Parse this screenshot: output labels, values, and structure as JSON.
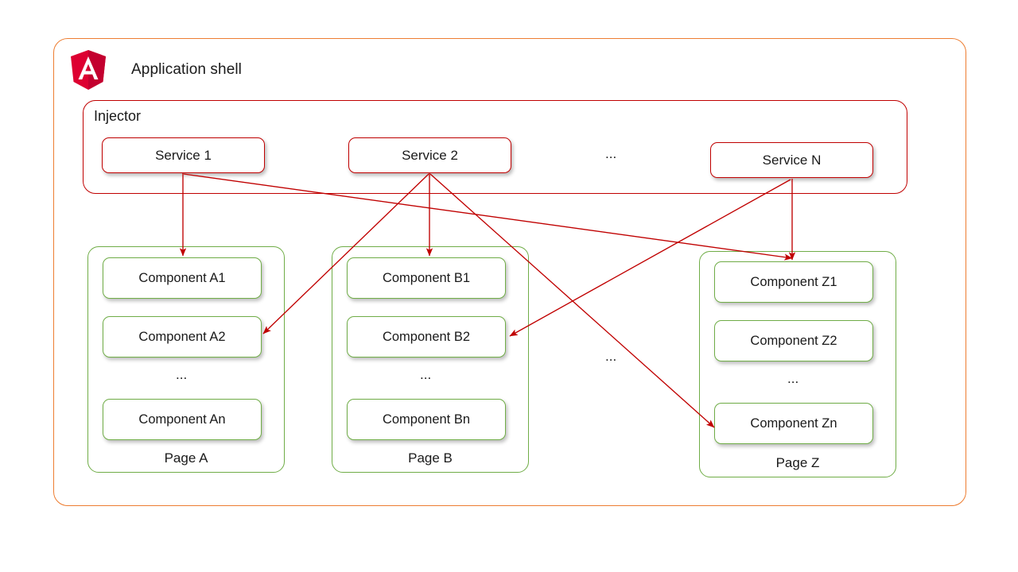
{
  "shell": {
    "title": "Application shell",
    "logo_icon": "angular-shield-icon",
    "border_color": "#ED7D31"
  },
  "injector": {
    "title": "Injector",
    "border_color": "#C00000",
    "services": [
      {
        "label": "Service 1"
      },
      {
        "label": "Service 2"
      },
      {
        "label": "Service N"
      }
    ],
    "services_ellipsis": "..."
  },
  "pages_ellipsis": "...",
  "pages": [
    {
      "label": "Page A",
      "border_color": "#70AD47",
      "components": [
        {
          "label": "Component A1"
        },
        {
          "label": "Component A2"
        },
        {
          "label": "Component An"
        }
      ],
      "ellipsis": "..."
    },
    {
      "label": "Page B",
      "border_color": "#70AD47",
      "components": [
        {
          "label": "Component B1"
        },
        {
          "label": "Component B2"
        },
        {
          "label": "Component Bn"
        }
      ],
      "ellipsis": "..."
    },
    {
      "label": "Page Z",
      "border_color": "#70AD47",
      "components": [
        {
          "label": "Component Z1"
        },
        {
          "label": "Component Z2"
        },
        {
          "label": "Component Zn"
        }
      ],
      "ellipsis": "..."
    }
  ],
  "connections": {
    "color": "#C00000",
    "edges": [
      {
        "from": "Service 1",
        "to": "Component A1"
      },
      {
        "from": "Service 1",
        "to": "Component Z1"
      },
      {
        "from": "Service 2",
        "to": "Component B1"
      },
      {
        "from": "Service 2",
        "to": "Component A2"
      },
      {
        "from": "Service 2",
        "to": "Component Zn"
      },
      {
        "from": "Service N",
        "to": "Component Z1"
      },
      {
        "from": "Service N",
        "to": "Component B2"
      }
    ]
  }
}
